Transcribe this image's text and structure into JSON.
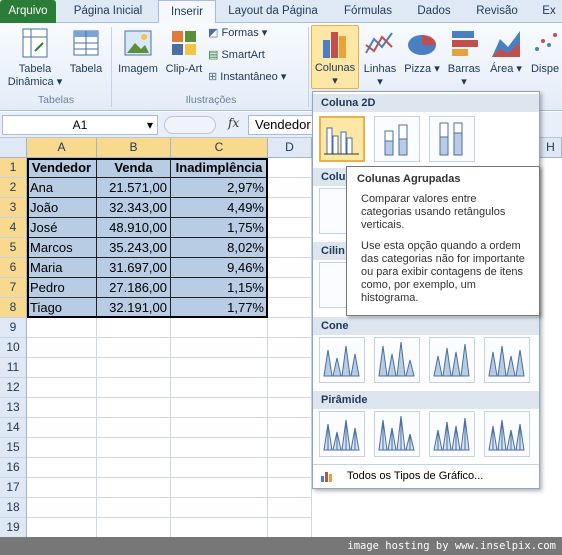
{
  "tabs": [
    "Arquivo",
    "Página Inicial",
    "Inserir",
    "Layout da Página",
    "Fórmulas",
    "Dados",
    "Revisão",
    "Ex"
  ],
  "ribbon": {
    "tabela_dinamica": "Tabela Dinâmica",
    "tabela": "Tabela",
    "imagem": "Imagem",
    "clipart": "Clip-Art",
    "formas": "Formas",
    "smartart": "SmartArt",
    "instantaneo": "Instantâneo",
    "colunas": "Colunas",
    "linhas": "Linhas",
    "pizza": "Pizza",
    "barras": "Barras",
    "area": "Área",
    "dispersao": "Dispe",
    "group_tabelas": "Tabelas",
    "group_ilustracoes": "Ilustrações"
  },
  "formula_bar": {
    "name_box": "A1",
    "fx": "fx",
    "content": "Vendedor"
  },
  "columns": [
    "A",
    "B",
    "C",
    "D",
    "H"
  ],
  "rows": [
    "1",
    "2",
    "3",
    "4",
    "5",
    "6",
    "7",
    "8",
    "9",
    "10",
    "11",
    "12",
    "13",
    "14",
    "15",
    "16",
    "17",
    "18",
    "19"
  ],
  "table": {
    "headers": [
      "Vendedor",
      "Venda",
      "Inadimplência"
    ],
    "rows": [
      [
        "Ana",
        "21.571,00",
        "2,97%"
      ],
      [
        "João",
        "32.343,00",
        "4,49%"
      ],
      [
        "José",
        "48.910,00",
        "1,75%"
      ],
      [
        "Marcos",
        "35.243,00",
        "8,02%"
      ],
      [
        "Maria",
        "31.697,00",
        "9,46%"
      ],
      [
        "Pedro",
        "27.186,00",
        "1,15%"
      ],
      [
        "Tiago",
        "32.191,00",
        "1,77%"
      ]
    ]
  },
  "gallery": {
    "coluna2d": "Coluna 2D",
    "coluna3d": "Colu",
    "cilindro": "Cilin",
    "cone": "Cone",
    "piramide": "Pirâmide",
    "todos": "Todos os Tipos de Gráfico..."
  },
  "tooltip": {
    "title": "Colunas Agrupadas",
    "p1": "Comparar valores entre categorias usando retângulos verticais.",
    "p2": "Use esta opção quando a ordem das categorias não for importante ou para exibir contagens de itens como, por exemplo, um histograma."
  },
  "footer": "image hosting by www.inselpix.com",
  "colors": {
    "accent": "#e8b04e",
    "file_tab": "#2a7d38",
    "selection": "#b8cce4"
  }
}
